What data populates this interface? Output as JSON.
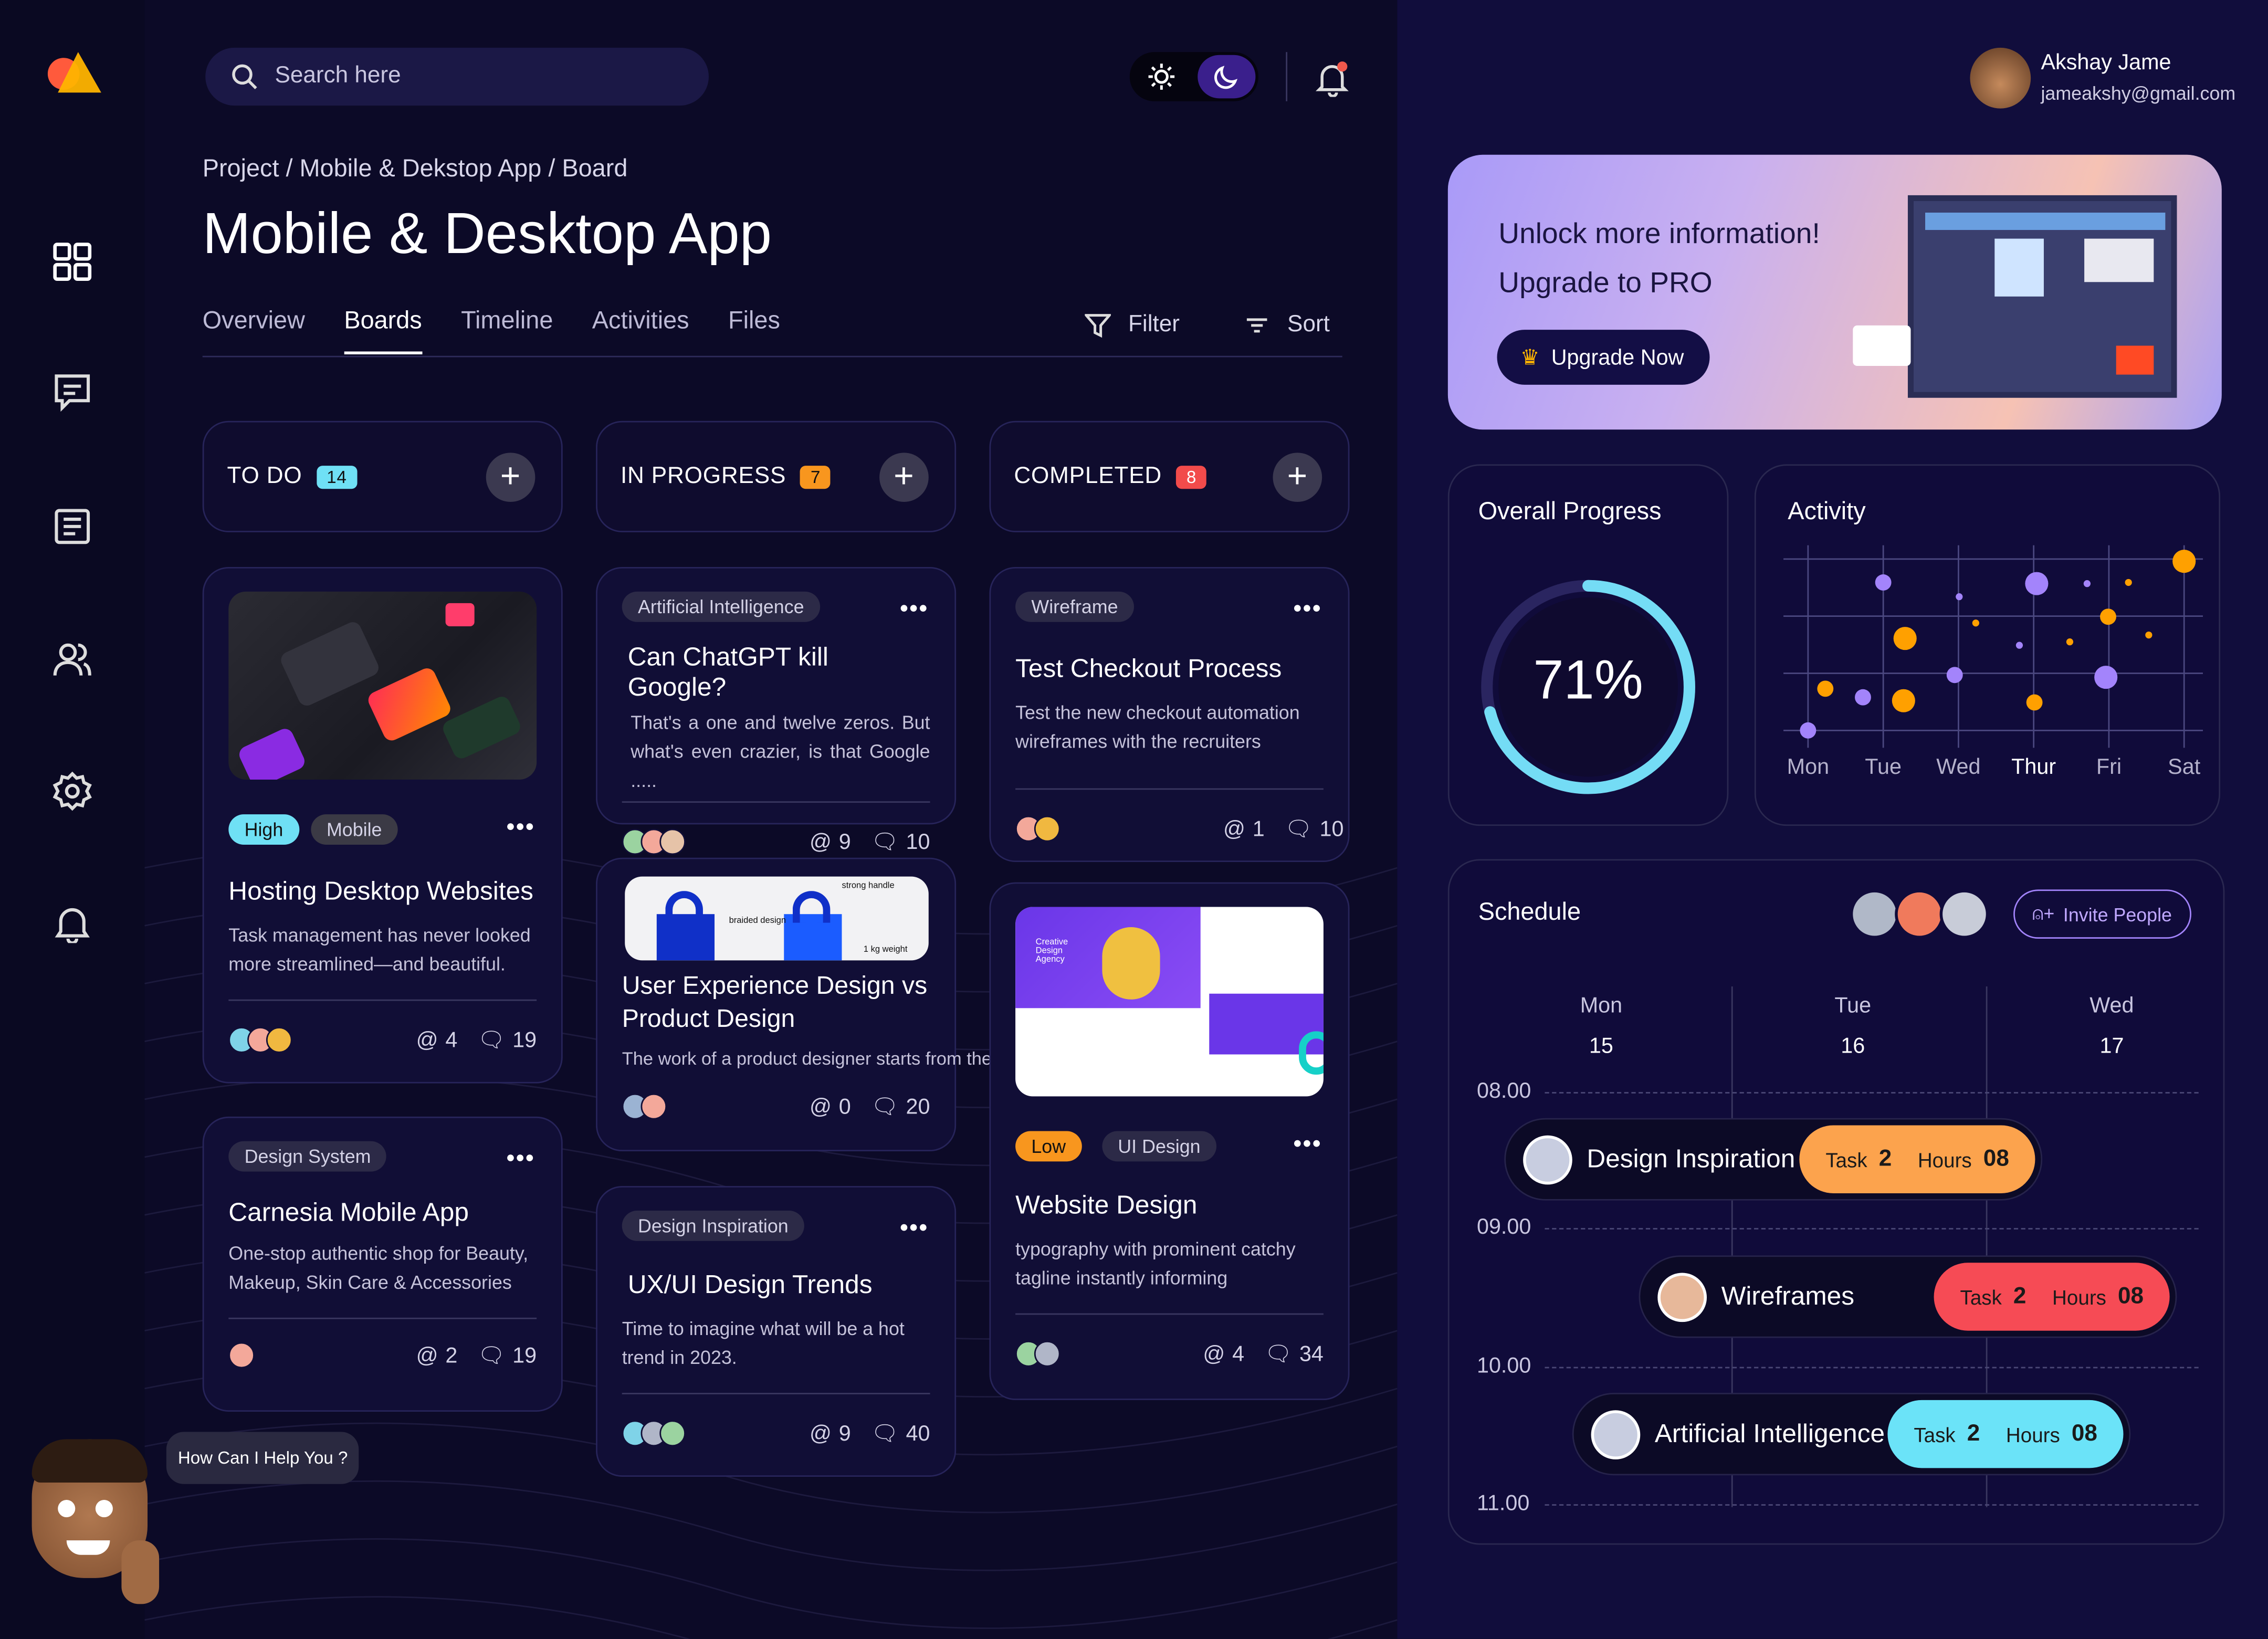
{
  "sidebar": {
    "logo": "brand-logo",
    "items": [
      "dashboard",
      "messages",
      "documents",
      "team",
      "settings",
      "notifications"
    ]
  },
  "header": {
    "search_placeholder": "Search here"
  },
  "breadcrumb": "Project / Mobile & Dekstop App / Board",
  "page_title": "Mobile & Desktop App",
  "tabs": [
    "Overview",
    "Boards",
    "Timeline",
    "Activities",
    "Files"
  ],
  "active_tab": "Boards",
  "toolbar": {
    "filter": "Filter",
    "sort": "Sort"
  },
  "columns": [
    {
      "title": "TO DO",
      "count": "14",
      "color": "#6fe0f5"
    },
    {
      "title": "IN PROGRESS",
      "count": "7",
      "color": "#f8961e"
    },
    {
      "title": "COMPLETED",
      "count": "8",
      "color": "#f24b4b"
    }
  ],
  "cards": {
    "hosting": {
      "tags": [
        "High",
        "Mobile"
      ],
      "title": "Hosting Desktop Websites",
      "desc": "Task management has never looked more streamlined—and beautiful.",
      "links": "4",
      "comments": "19"
    },
    "carnesia": {
      "tag": "Design System",
      "title": "Carnesia Mobile App",
      "desc": "One-stop authentic shop for Beauty, Makeup, Skin Care & Accessories",
      "links": "2",
      "comments": "19"
    },
    "chatgpt": {
      "tag": "Artificial Intelligence",
      "title": "Can ChatGPT kill Google?",
      "desc": "That's a one and twelve zeros. But what's even crazier, is that Google .....",
      "links": "9",
      "comments": "10"
    },
    "ux": {
      "title": "User Experience Design vs Product Design",
      "desc": "The work of a product designer starts from the beginning of the product  process.",
      "links": "0",
      "comments": "20",
      "img_labels": [
        "braided design",
        "strong handle",
        "1 kg weight"
      ]
    },
    "trends": {
      "tag": "Design Inspiration",
      "title": "UX/UI Design Trends",
      "desc": "Time to imagine what will be a hot trend in 2023.",
      "links": "9",
      "comments": "40"
    },
    "checkout": {
      "tag": "Wireframe",
      "title": "Test Checkout Process",
      "desc": "Test the new checkout automation wireframes with the recruiters",
      "links": "1",
      "comments": "10"
    },
    "website": {
      "tags": [
        "Low",
        "UI Design"
      ],
      "title": "Website Design",
      "desc": "typography with prominent catchy tagline instantly informing",
      "links": "4",
      "comments": "34",
      "img_text": "Creative Design Agency"
    }
  },
  "chatbot": {
    "message": "How Can I  Help You ?"
  },
  "user": {
    "name": "Akshay Jame",
    "email": "jameakshy@gmail.com"
  },
  "promo": {
    "line1": "Unlock more information!",
    "line2": "Upgrade to PRO",
    "button": "Upgrade Now"
  },
  "progress": {
    "title": "Overall Progress",
    "value": 71,
    "label": "71%"
  },
  "chart_data": {
    "type": "scatter",
    "title": "Activity",
    "categories": [
      "Mon",
      "Tue",
      "Wed",
      "Thur",
      "Fri",
      "Sat"
    ],
    "highlight": "Thur",
    "ylim": [
      0,
      3
    ],
    "grid": true,
    "series": [
      {
        "name": "purple",
        "color": "#a384fb",
        "points": [
          [
            0,
            0,
            2
          ],
          [
            0.73,
            0.58,
            2
          ],
          [
            1,
            2.59,
            2
          ],
          [
            2.01,
            2.34,
            1
          ],
          [
            1.95,
            0.97,
            2
          ],
          [
            2.81,
            1.49,
            1
          ],
          [
            3.04,
            2.57,
            3
          ],
          [
            3.71,
            2.57,
            1
          ],
          [
            3.96,
            0.93,
            3
          ]
        ]
      },
      {
        "name": "orange",
        "color": "#ffa000",
        "points": [
          [
            0.23,
            0.73,
            2
          ],
          [
            1.29,
            1.61,
            3
          ],
          [
            1.27,
            0.52,
            3
          ],
          [
            2.23,
            1.88,
            1
          ],
          [
            3.01,
            0.49,
            2
          ],
          [
            3.48,
            1.55,
            1
          ],
          [
            3.99,
            1.99,
            2
          ],
          [
            4.26,
            2.59,
            1
          ],
          [
            4.53,
            1.67,
            1
          ],
          [
            5,
            2.96,
            3
          ]
        ]
      }
    ]
  },
  "schedule": {
    "title": "Schedule",
    "invite": "Invite People",
    "days": [
      {
        "name": "Mon",
        "date": "15"
      },
      {
        "name": "Tue",
        "date": "16"
      },
      {
        "name": "Wed",
        "date": "17"
      }
    ],
    "times": [
      "08.00",
      "09.00",
      "10.00",
      "11.00"
    ],
    "events": [
      {
        "title": "Design Inspiration",
        "task_label": "Task",
        "task": "2",
        "hours_label": "Hours",
        "hours": "08",
        "color": "#fca34d"
      },
      {
        "title": "Wireframes",
        "task_label": "Task",
        "task": "2",
        "hours_label": "Hours",
        "hours": "08",
        "color": "#f64b55"
      },
      {
        "title": "Artificial Intelligence",
        "task_label": "Task",
        "task": "2",
        "hours_label": "Hours",
        "hours": "08",
        "color": "#6be3f8"
      }
    ]
  }
}
